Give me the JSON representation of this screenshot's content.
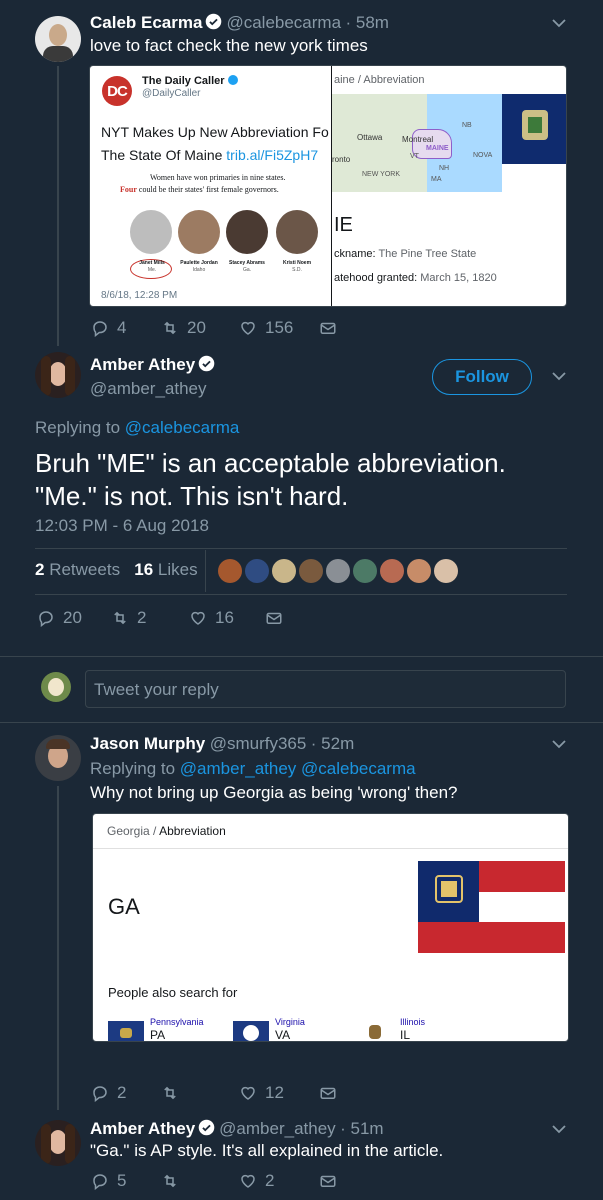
{
  "tweet1": {
    "name": "Caleb Ecarma",
    "handle": "@calebecarma",
    "time": "· 58m",
    "text": "love to fact check the new york times",
    "actions": {
      "replies": "4",
      "retweets": "20",
      "likes": "156"
    },
    "screenshot": {
      "brand_logo": "DC",
      "brand_name": "The Daily Caller",
      "brand_handle": "@DailyCaller",
      "headline_1": "NYT Makes Up New Abbreviation Fo",
      "headline_2": "The State Of Maine",
      "headline_link": "trib.al/Fi5ZpH7",
      "excerpt_1": "Women have won primaries in nine states.",
      "excerpt_2_highlight": "Four",
      "excerpt_2_rest": "could be their states' first female governors.",
      "photo_labels": [
        "Janet Mills",
        "Paulette Jordan",
        "Stacey Abrams",
        "Kristi Noem"
      ],
      "photo_sublabels": [
        "Me.",
        "Idaho",
        "Ga.",
        "S.D."
      ],
      "date": "8/6/18, 12:28 PM",
      "right_crumb": "aine / Abbreviation",
      "map_labels": [
        "NB",
        "Ottawa",
        "Montreal",
        "MAINE",
        "NOVA",
        "VT",
        "ronto",
        "NH",
        "NEW YORK",
        "MA"
      ],
      "abbr": "IE",
      "nickname_label": "ckname:",
      "nickname_value": "The Pine Tree State",
      "statehood_label": "atehood granted:",
      "statehood_value": "March 15, 1820"
    }
  },
  "main": {
    "name": "Amber Athey",
    "handle": "@amber_athey",
    "follow_label": "Follow",
    "replying_prefix": "Replying to",
    "replying_to": "@calebecarma",
    "text_line1": "Bruh \"ME\" is an acceptable abbreviation.",
    "text_line2": "\"Me.\" is not. This isn't hard.",
    "timestamp": "12:03 PM - 6 Aug 2018",
    "retweets_count": "2",
    "retweets_label": "Retweets",
    "likes_count": "16",
    "likes_label": "Likes",
    "actions": {
      "replies": "20",
      "retweets": "2",
      "likes": "16"
    }
  },
  "reply_box": {
    "placeholder": "Tweet your reply"
  },
  "tweet2": {
    "name": "Jason Murphy",
    "handle": "@smurfy365",
    "time": "· 52m",
    "replying_prefix": "Replying to",
    "replying_to": "@amber_athey @calebecarma",
    "text": "Why not bring up Georgia as being 'wrong' then?",
    "actions": {
      "replies": "2",
      "retweets": "",
      "likes": "12"
    },
    "card": {
      "crumb_state": "Georgia",
      "crumb_sep": "/",
      "crumb_page": "Abbreviation",
      "abbr": "GA",
      "also_search": "People also search for",
      "related": [
        {
          "state": "Pennsylvania",
          "abbr": "PA"
        },
        {
          "state": "Virginia",
          "abbr": "VA"
        },
        {
          "state": "Illinois",
          "abbr": "IL"
        }
      ]
    }
  },
  "tweet3": {
    "name": "Amber Athey",
    "handle": "@amber_athey",
    "time": "· 51m",
    "text": "\"Ga.\" is AP style. It's all explained in the article.",
    "actions": {
      "replies": "5",
      "retweets": "",
      "likes": "2"
    }
  },
  "colors": {
    "background": "#1b2836",
    "accent": "#1b95e0",
    "muted": "#8899a6",
    "divider": "#38444d",
    "text": "#ffffff"
  }
}
